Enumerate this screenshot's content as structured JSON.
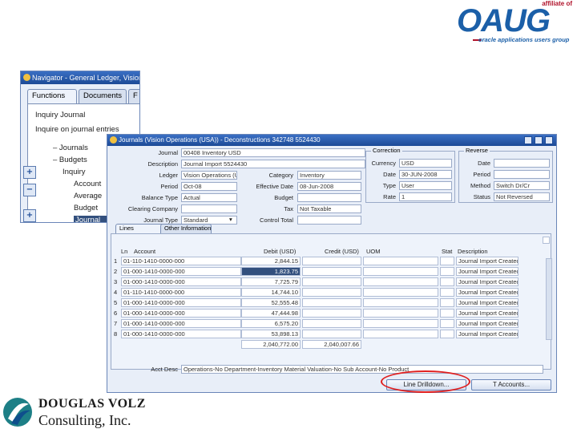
{
  "logo_oaug": {
    "affiliate": "affiliate of",
    "name": "OAUG",
    "tagline": "oracle applications users group"
  },
  "navigator": {
    "title": "Navigator - General Ledger, Vision",
    "tabs": [
      "Functions",
      "Documents",
      "F"
    ],
    "items": [
      "Inquiry Journal",
      "Inquire on journal entries"
    ],
    "tree": [
      "– Journals",
      "– Budgets",
      "Inquiry",
      "Account",
      "Average",
      "Budget",
      "Journal"
    ],
    "buttons": [
      "+",
      "−",
      "+"
    ]
  },
  "journals": {
    "title": "Journals (Vision Operations (USA)) - Deconstructions 342748 5524430",
    "labels": {
      "journal": "Journal",
      "description": "Description",
      "ledger": "Ledger",
      "period": "Period",
      "balance_type": "Balance Type",
      "clearing_company": "Clearing Company",
      "journal_type": "Journal Type",
      "category": "Category",
      "effective_date": "Effective Date",
      "budget": "Budget",
      "tax": "Tax",
      "control_total": "Control Total",
      "correction": "Correction",
      "currency": "Currency",
      "date": "Date",
      "type": "Type",
      "rate": "Rate",
      "reverse": "Reverse",
      "rdate": "Date",
      "rperiod": "Period",
      "method": "Method",
      "status": "Status"
    },
    "values": {
      "journal": "00408 Inventory USD",
      "description": "Journal Import 5524430",
      "ledger": "Vision Operations (US",
      "period": "Oct-08",
      "balance_type": "Actual",
      "journal_type": "Standard",
      "category": "Inventory",
      "effective_date": "08-Jun-2008",
      "tax": "Not Taxable",
      "currency": "USD",
      "date": "30-JUN-2008",
      "type": "User",
      "rate": "1",
      "method": "Switch Dr/Cr",
      "status": "Not Reversed"
    },
    "tabs": [
      "Lines",
      "Other Information"
    ],
    "columns": [
      "Ln",
      "Account",
      "Debit (USD)",
      "Credit (USD)",
      "UOM",
      "Stat",
      "Description"
    ],
    "rows": [
      {
        "n": "1",
        "acct": "01-110-1410-0000-000",
        "debit": "2,844.15",
        "credit": "",
        "desc": "Journal Import Created"
      },
      {
        "n": "2",
        "acct": "01-000-1410-0000-000",
        "debit": "1,823.75",
        "credit": "",
        "desc": "Journal Import Created"
      },
      {
        "n": "3",
        "acct": "01-000-1410-0000-000",
        "debit": "7,725.79",
        "credit": "",
        "desc": "Journal Import Created"
      },
      {
        "n": "4",
        "acct": "01-110-1410-0000-000",
        "debit": "14,744.10",
        "credit": "",
        "desc": "Journal Import Created"
      },
      {
        "n": "5",
        "acct": "01-000-1410-0000-000",
        "debit": "52,555.48",
        "credit": "",
        "desc": "Journal Import Created"
      },
      {
        "n": "6",
        "acct": "01-000-1410-0000-000",
        "debit": "47,444.98",
        "credit": "",
        "desc": "Journal Import Created"
      },
      {
        "n": "7",
        "acct": "01-000-1410-0000-000",
        "debit": "6,575.20",
        "credit": "",
        "desc": "Journal Import Created"
      },
      {
        "n": "8",
        "acct": "01-000-1410-0000-000",
        "debit": "53,898.13",
        "credit": "",
        "desc": "Journal Import Created"
      }
    ],
    "totals": {
      "debit": "2,040,772.00",
      "credit": "2,040,007.66"
    },
    "acct_desc_label": "Acct Desc",
    "acct_desc_value": "Operations-No Department-Inventory Material Valuation-No Sub Account-No Product",
    "buttons": {
      "line_drilldown": "Line Drilldown...",
      "t_accounts": "T Accounts..."
    }
  },
  "logo_dv": {
    "line1": "DOUGLAS VOLZ",
    "line2": "Consulting, Inc."
  }
}
